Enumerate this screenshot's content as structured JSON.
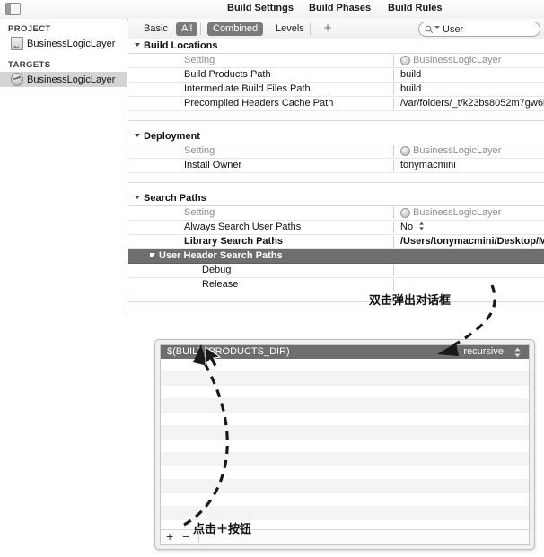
{
  "window": {
    "panel_toggle_icon": "panel-toggle-icon",
    "tabs": [
      {
        "id": "build-settings",
        "label": "Build Settings",
        "selected": true
      },
      {
        "id": "build-phases",
        "label": "Build Phases",
        "selected": false
      },
      {
        "id": "build-rules",
        "label": "Build Rules",
        "selected": false
      }
    ]
  },
  "sidebar": {
    "project_header": "PROJECT",
    "project_item": "BusinessLogicLayer",
    "targets_header": "TARGETS",
    "target_item": "BusinessLogicLayer"
  },
  "filterbar": {
    "segments": [
      {
        "id": "basic",
        "label": "Basic",
        "selected": false
      },
      {
        "id": "all",
        "label": "All",
        "selected": true
      },
      {
        "id": "combined",
        "label": "Combined",
        "selected": true
      },
      {
        "id": "levels",
        "label": "Levels",
        "selected": false
      }
    ],
    "add_label": "+",
    "search": {
      "icon": "search-icon",
      "value": "User",
      "placeholder": "User"
    }
  },
  "settings": {
    "column_setting_label": "Setting",
    "column_target_label": "BusinessLogicLayer",
    "groups": [
      {
        "title": "Build Locations",
        "rows": [
          {
            "name": "Build Products Path",
            "value": "build"
          },
          {
            "name": "Intermediate Build Files Path",
            "value": "build"
          },
          {
            "name": "Precompiled Headers Cache Path",
            "value": "/var/folders/_t/k23bs8052m7gw6b"
          }
        ]
      },
      {
        "title": "Deployment",
        "rows": [
          {
            "name": "Install Owner",
            "value": "tonymacmini"
          }
        ]
      },
      {
        "title": "Search Paths",
        "rows": [
          {
            "name": "Always Search User Paths",
            "value": "No",
            "stepper": true
          },
          {
            "name": "Library Search Paths",
            "value": "/Users/tonymacmini/Desktop/M",
            "bold": true
          },
          {
            "name": "User Header Search Paths",
            "value": "",
            "selected": true,
            "expanded": true
          },
          {
            "name": "Debug",
            "value": "",
            "sub": true
          },
          {
            "name": "Release",
            "value": "",
            "sub": true
          }
        ]
      }
    ]
  },
  "dialog": {
    "path_value": "$(BUILT_PRODUCTS_DIR)",
    "scope_value": "recursive",
    "stepper_icon": "stepper-updown-icon",
    "add_button": "+",
    "remove_button": "−",
    "empty_rows": 14
  },
  "annotations": [
    {
      "id": "double-click",
      "text": "双击弹出对话框"
    },
    {
      "id": "click-plus",
      "text": "点击＋按钮"
    }
  ],
  "colors": {
    "selection_gray": "#6e6e6e",
    "segment_on": "#7a7a7a",
    "sidebar_selected": "#d4d4d4",
    "border": "#c2c2c2"
  }
}
